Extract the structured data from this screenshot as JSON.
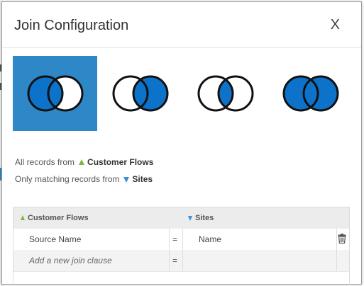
{
  "dialog": {
    "title": "Join Configuration",
    "close_label": "X"
  },
  "join_types": [
    {
      "id": "left-outer",
      "selected": true
    },
    {
      "id": "right-outer",
      "selected": false
    },
    {
      "id": "inner",
      "selected": false
    },
    {
      "id": "full-outer",
      "selected": false
    }
  ],
  "summary": {
    "line1_prefix": "All records from",
    "line1_entity": "Customer Flows",
    "line2_prefix": "Only matching records from",
    "line2_entity": "Sites"
  },
  "grid": {
    "left_header": "Customer Flows",
    "right_header": "Sites",
    "rows": [
      {
        "left": "Source Name",
        "op": "=",
        "right": "Name"
      },
      {
        "left": "Add a new join clause",
        "op": "=",
        "right": ""
      }
    ]
  },
  "colors": {
    "accent": "#2e87c7",
    "fill_blue": "#0d72c9",
    "left_entity": "#7ab83d",
    "right_entity": "#3b8fd4"
  },
  "icons": [
    "venn-left-icon",
    "venn-right-icon",
    "venn-inner-icon",
    "venn-full-icon",
    "triangle-up-icon",
    "triangle-down-icon",
    "trash-icon"
  ]
}
